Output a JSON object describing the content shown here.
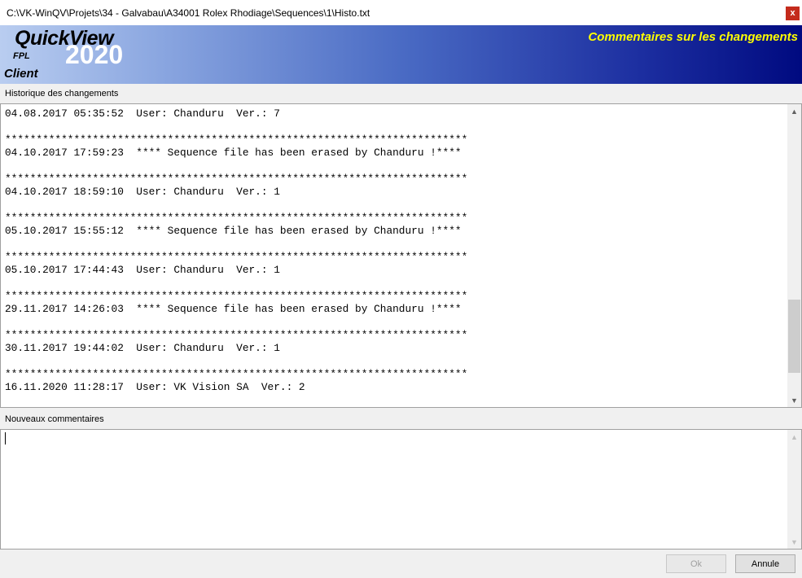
{
  "window": {
    "title": "C:\\VK-WinQV\\Projets\\34 - Galvabau\\A34001 Rolex Rhodiage\\Sequences\\1\\Histo.txt",
    "close_label": "x"
  },
  "banner": {
    "logo_name": "QuickView",
    "logo_sub": "FPL",
    "logo_year": "2020",
    "logo_client": "Client",
    "title": "Commentaires sur les changements",
    "gradient_colors": [
      "#b9cdf0",
      "#000a80"
    ],
    "title_color": "#ffff00"
  },
  "history": {
    "label": "Historique des changements",
    "lines": [
      "04.08.2017 05:35:52  User: Chanduru  Ver.: 7",
      "",
      "**************************************************************************",
      "04.10.2017 17:59:23  **** Sequence file has been erased by Chanduru !****",
      "",
      "**************************************************************************",
      "04.10.2017 18:59:10  User: Chanduru  Ver.: 1",
      "",
      "**************************************************************************",
      "05.10.2017 15:55:12  **** Sequence file has been erased by Chanduru !****",
      "",
      "**************************************************************************",
      "05.10.2017 17:44:43  User: Chanduru  Ver.: 1",
      "",
      "**************************************************************************",
      "29.11.2017 14:26:03  **** Sequence file has been erased by Chanduru !****",
      "",
      "**************************************************************************",
      "30.11.2017 19:44:02  User: Chanduru  Ver.: 1",
      "",
      "**************************************************************************",
      "16.11.2020 11:28:17  User: VK Vision SA  Ver.: 2"
    ],
    "scroll_position": 0.9
  },
  "comments": {
    "label": "Nouveaux commentaires",
    "value": ""
  },
  "buttons": {
    "ok_label": "Ok",
    "cancel_label": "Annule"
  }
}
